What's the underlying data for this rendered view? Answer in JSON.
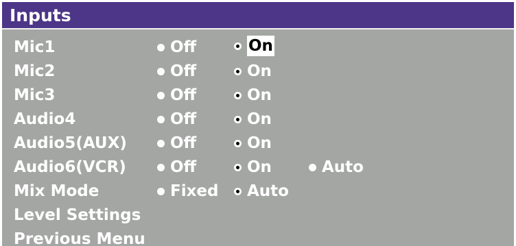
{
  "title": "Inputs",
  "rows": [
    {
      "label": "Mic1",
      "opt1": "Off",
      "opt2": "On"
    },
    {
      "label": "Mic2",
      "opt1": "Off",
      "opt2": "On"
    },
    {
      "label": "Mic3",
      "opt1": "Off",
      "opt2": "On"
    },
    {
      "label": "Audio4",
      "opt1": "Off",
      "opt2": "On"
    },
    {
      "label": "Audio5(AUX)",
      "opt1": "Off",
      "opt2": "On"
    },
    {
      "label": "Audio6(VCR)",
      "opt1": "Off",
      "opt2": "On",
      "opt3": "Auto"
    },
    {
      "label": "Mix Mode",
      "opt1": "Fixed",
      "opt2": "Auto"
    }
  ],
  "menu": {
    "level_settings": "Level Settings",
    "previous_menu": "Previous Menu"
  },
  "colors": {
    "titlebar": "#4d3587",
    "panel": "#a4a6a4",
    "text": "#ffffff",
    "highlight_bg": "#ffffff",
    "highlight_text": "#000000"
  }
}
